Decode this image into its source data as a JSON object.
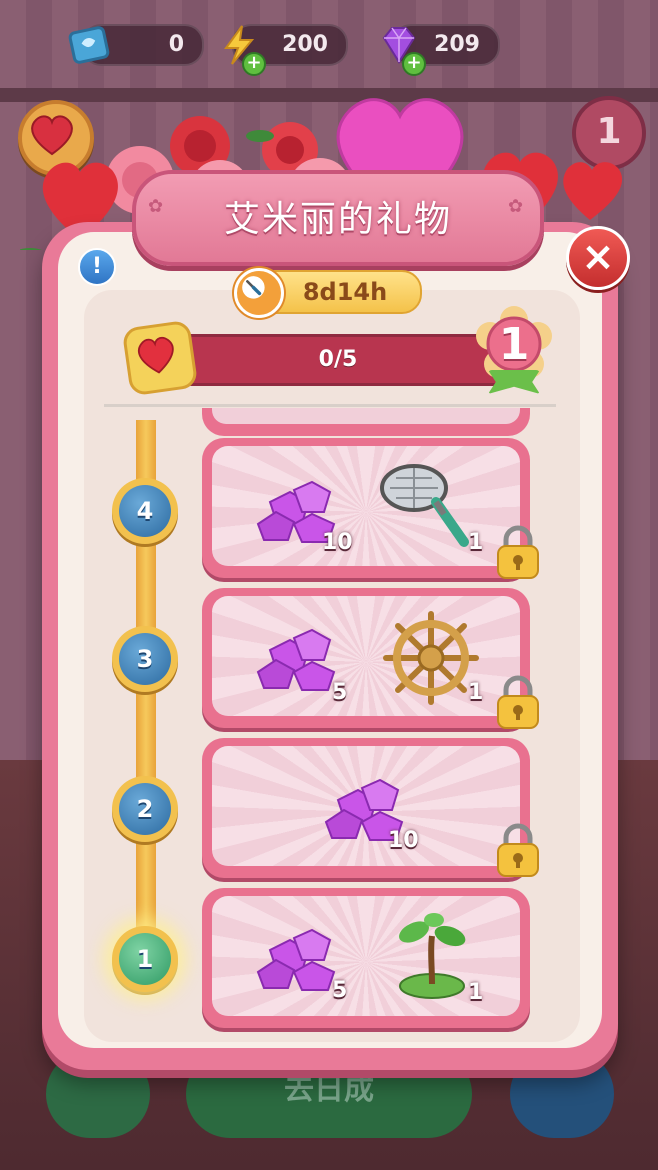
{
  "resources": {
    "tickets": "0",
    "energy": "200",
    "gems": "209"
  },
  "top_level": "1",
  "panel": {
    "title": "艾米丽的礼物",
    "info_icon": "!",
    "close_icon": "×",
    "timer": "8d14h",
    "progress_text": "0/5",
    "progress": {
      "current": 0,
      "total": 5
    },
    "level": "1"
  },
  "rewards": [
    {
      "tier": "4",
      "locked": true,
      "items": [
        {
          "type": "gems",
          "qty": "10"
        },
        {
          "type": "net-strainer",
          "qty": "1"
        }
      ]
    },
    {
      "tier": "3",
      "locked": true,
      "items": [
        {
          "type": "gems",
          "qty": "5"
        },
        {
          "type": "woven-wheel",
          "qty": "1"
        }
      ]
    },
    {
      "tier": "2",
      "locked": true,
      "items": [
        {
          "type": "gems",
          "qty": "10"
        }
      ]
    },
    {
      "tier": "1",
      "locked": false,
      "items": [
        {
          "type": "gems",
          "qty": "5"
        },
        {
          "type": "sapling",
          "qty": "1"
        }
      ]
    }
  ],
  "background_button": "去日成",
  "colors": {
    "panel": "#e97a98",
    "panel_inner": "#f8efe8",
    "progress_bar": "#b8354f",
    "track": "#f2c14e",
    "node_blue": "#2c6aa0",
    "node_green": "#2f9a64",
    "gem_purple": "#c955e8"
  }
}
